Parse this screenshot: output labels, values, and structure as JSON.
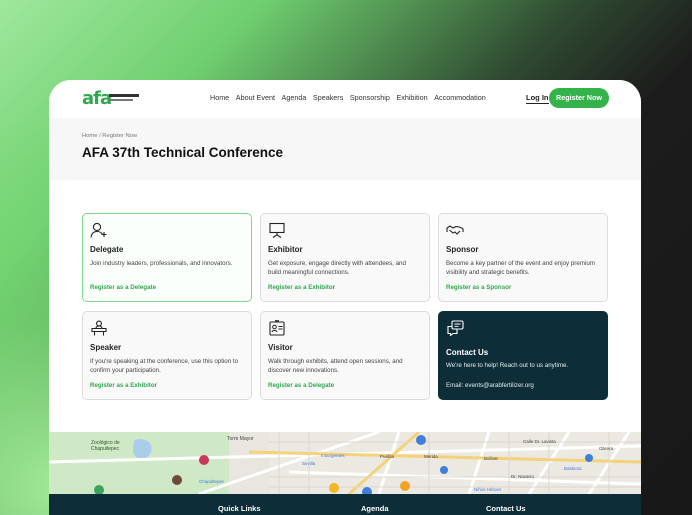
{
  "header": {
    "logo_text": "afa",
    "nav": [
      "Home",
      "About Event",
      "Agenda",
      "Speakers",
      "Sponsorship",
      "Exhibition",
      "Accommodation"
    ],
    "login_label": "Log In",
    "register_label": "Register Now"
  },
  "page": {
    "breadcrumb": "Home / Register Now",
    "title": "AFA 37th Technical Conference"
  },
  "cards": [
    {
      "title": "Delegate",
      "desc": "Join industry leaders, professionals, and innovators.",
      "link": "Register as a Delegate",
      "icon": "user-plus-icon"
    },
    {
      "title": "Exhibitor",
      "desc": "Get exposure, engage directly with attendees, and build meaningful connections.",
      "link": "Register as a Exhibitor",
      "icon": "presentation-board-icon"
    },
    {
      "title": "Sponsor",
      "desc": "Become a key partner of the event and enjoy premium visibility and strategic benefits.",
      "link": "Register as a Sponsor",
      "icon": "handshake-icon"
    },
    {
      "title": "Speaker",
      "desc": "If you're speaking at the conference, use this option to confirm your participation.",
      "link": "Register as a Exhibitor",
      "icon": "speaker-podium-icon"
    },
    {
      "title": "Visitor",
      "desc": "Walk through exhibits, attend open sessions, and discover new innovations.",
      "link": "Register as a Delegate",
      "icon": "id-badge-icon"
    },
    {
      "title": "Contact Us",
      "desc": "We're here to help! Reach out to us anytime.",
      "email": "Email: events@arabfertilizer.org",
      "icon": "chat-bubbles-icon"
    }
  ],
  "map": {
    "labels": [
      "Zoológico de Chapultepec",
      "Torre Mayor",
      "Calle Dr. Lavista",
      "Sevilla",
      "Insurgentes",
      "Chapultepec",
      "Puebla",
      "Mérida",
      "Obrera",
      "Bolívar",
      "Niños Héroes",
      "Balderas",
      "Dr. Navarro"
    ]
  },
  "footer": {
    "headings": [
      "Quick Links",
      "Agenda",
      "Contact Us"
    ]
  },
  "colors": {
    "accent": "#34b34a",
    "dark": "#0d2e38"
  }
}
